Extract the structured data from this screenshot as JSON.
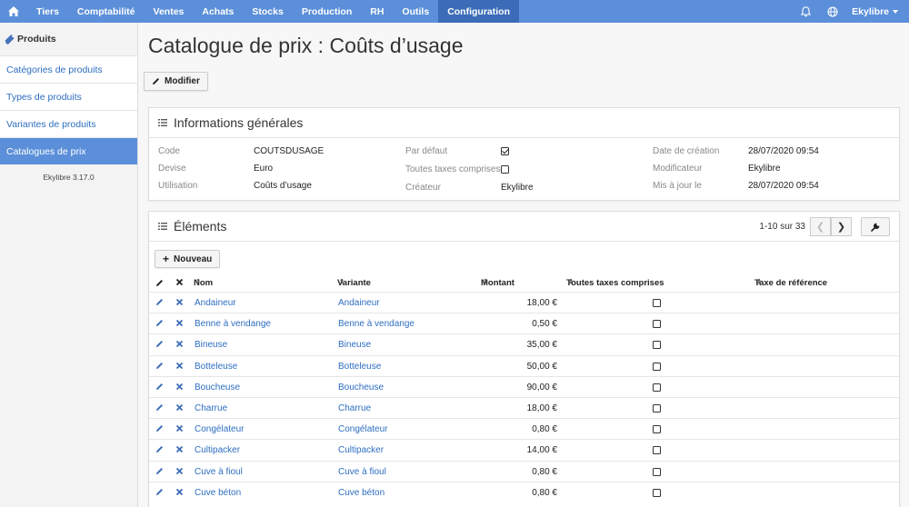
{
  "nav": {
    "items": [
      {
        "label": "Tiers",
        "active": false
      },
      {
        "label": "Comptabilité",
        "active": false
      },
      {
        "label": "Ventes",
        "active": false
      },
      {
        "label": "Achats",
        "active": false
      },
      {
        "label": "Stocks",
        "active": false
      },
      {
        "label": "Production",
        "active": false
      },
      {
        "label": "RH",
        "active": false
      },
      {
        "label": "Outils",
        "active": false
      },
      {
        "label": "Configuration",
        "active": true
      }
    ],
    "user": "Ekylibre",
    "icons": [
      "home-icon",
      "bell-icon",
      "globe-icon"
    ],
    "colors": {
      "bar": "#5b8fd9",
      "active": "#3c6cb8"
    }
  },
  "sidebar": {
    "title": "Produits",
    "items": [
      {
        "label": "Catégories de produits",
        "active": false
      },
      {
        "label": "Types de produits",
        "active": false
      },
      {
        "label": "Variantes de produits",
        "active": false
      },
      {
        "label": "Catalogues de prix",
        "active": true
      }
    ],
    "version": "Ekylibre 3.17.0"
  },
  "page": {
    "title": "Catalogue de prix : Coûts d’usage",
    "modify_label": "Modifier"
  },
  "info": {
    "title": "Informations générales",
    "code_label": "Code",
    "code": "COUTSDUSAGE",
    "currency_label": "Devise",
    "currency": "Euro",
    "usage_label": "Utilisation",
    "usage": "Coûts d’usage",
    "default_label": "Par défaut",
    "default_checked": true,
    "all_taxes_label": "Toutes taxes comprises",
    "all_taxes_checked": false,
    "creator_label": "Créateur",
    "creator": "Ekylibre",
    "created_label": "Date de création",
    "created": "28/07/2020 09:54",
    "modifier_label": "Modificateur",
    "modifier": "Ekylibre",
    "updated_label": "Mis à jour le",
    "updated": "28/07/2020 09:54"
  },
  "elements": {
    "title": "Éléments",
    "pagination": "1-10 sur 33",
    "new_label": "Nouveau",
    "columns": {
      "name": "Nom",
      "variant": "Variante",
      "amount": "Montant",
      "all_taxes": "Toutes taxes comprises",
      "reference_tax": "Taxe de référence"
    },
    "rows": [
      {
        "name": "Andaineur",
        "variant": "Andaineur",
        "amount": "18,00 €",
        "all_taxes": false
      },
      {
        "name": "Benne à vendange",
        "variant": "Benne à vendange",
        "amount": "0,50 €",
        "all_taxes": false
      },
      {
        "name": "Bineuse",
        "variant": "Bineuse",
        "amount": "35,00 €",
        "all_taxes": false
      },
      {
        "name": "Botteleuse",
        "variant": "Botteleuse",
        "amount": "50,00 €",
        "all_taxes": false
      },
      {
        "name": "Boucheuse",
        "variant": "Boucheuse",
        "amount": "90,00 €",
        "all_taxes": false
      },
      {
        "name": "Charrue",
        "variant": "Charrue",
        "amount": "18,00 €",
        "all_taxes": false
      },
      {
        "name": "Congélateur",
        "variant": "Congélateur",
        "amount": "0,80 €",
        "all_taxes": false
      },
      {
        "name": "Cultipacker",
        "variant": "Cultipacker",
        "amount": "14,00 €",
        "all_taxes": false
      },
      {
        "name": "Cuve à fioul",
        "variant": "Cuve à fioul",
        "amount": "0,80 €",
        "all_taxes": false
      },
      {
        "name": "Cuve béton",
        "variant": "Cuve béton",
        "amount": "0,80 €",
        "all_taxes": false
      }
    ]
  }
}
